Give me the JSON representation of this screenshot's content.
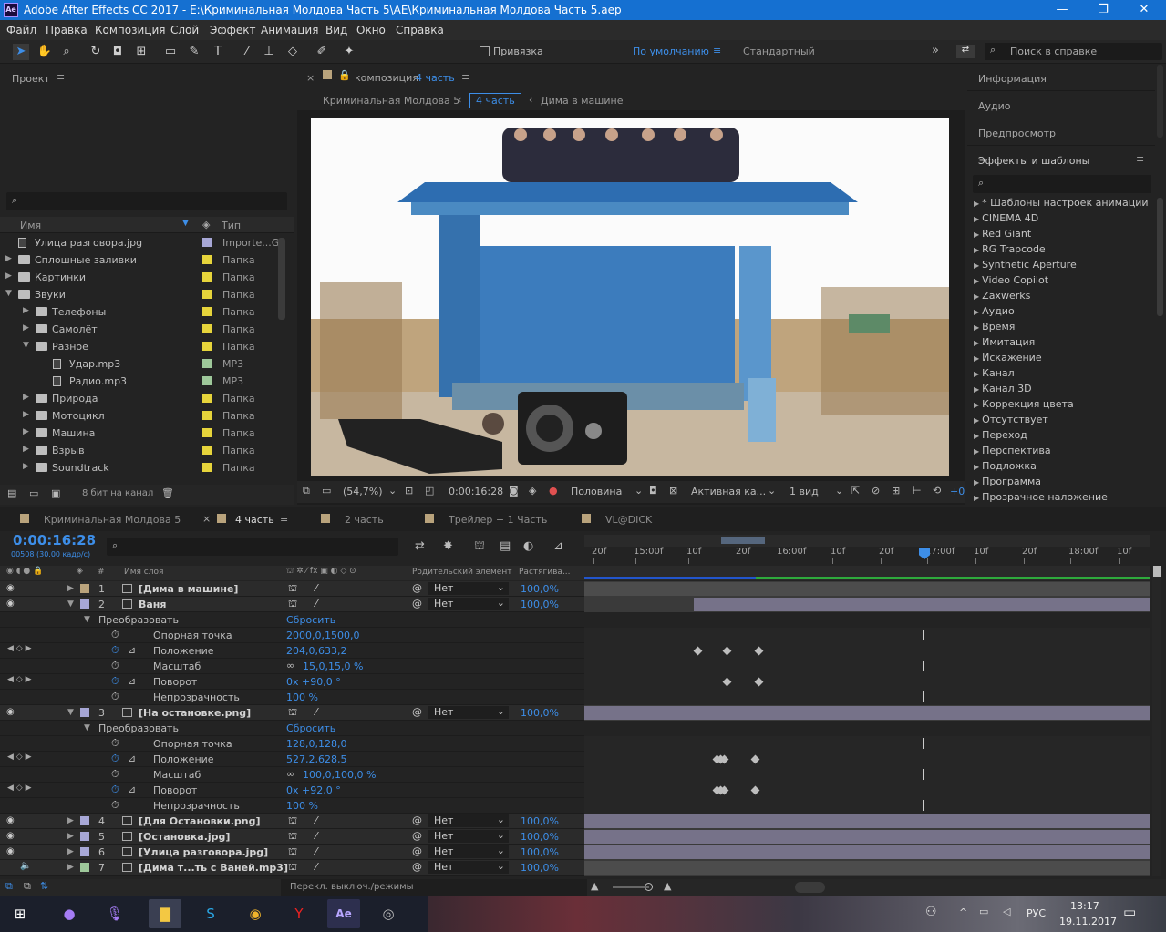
{
  "window": {
    "title": "Adobe After Effects CC 2017 - E:\\Криминальная Молдова Часть 5\\AE\\Криминальная Молдова Часть 5.aep",
    "logo": "Ae"
  },
  "menu": [
    "Файл",
    "Правка",
    "Композиция",
    "Слой",
    "Эффект",
    "Анимация",
    "Вид",
    "Окно",
    "Справка"
  ],
  "toolbar": {
    "snap_label": "Привязка",
    "workspace_active": "По умолчанию",
    "workspace_other": "Стандартный",
    "search_placeholder": "Поиск в справке"
  },
  "project": {
    "title": "Проект",
    "col_name": "Имя",
    "col_type": "Тип",
    "items": [
      {
        "name": "Улица разговора.jpg",
        "type": "Importe...G",
        "color": "#a7a7d6",
        "indent": 0,
        "kind": "file"
      },
      {
        "name": "Сплошные заливки",
        "type": "Папка",
        "color": "#e6d43b",
        "indent": 0,
        "kind": "folder"
      },
      {
        "name": "Картинки",
        "type": "Папка",
        "color": "#e6d43b",
        "indent": 0,
        "kind": "folder"
      },
      {
        "name": "Звуки",
        "type": "Папка",
        "color": "#e6d43b",
        "indent": 0,
        "kind": "folder-open"
      },
      {
        "name": "Телефоны",
        "type": "Папка",
        "color": "#e6d43b",
        "indent": 1,
        "kind": "folder"
      },
      {
        "name": "Самолёт",
        "type": "Папка",
        "color": "#e6d43b",
        "indent": 1,
        "kind": "folder"
      },
      {
        "name": "Разное",
        "type": "Папка",
        "color": "#e6d43b",
        "indent": 1,
        "kind": "folder-open"
      },
      {
        "name": "Удар.mp3",
        "type": "MP3",
        "color": "#9ec89a",
        "indent": 2,
        "kind": "file"
      },
      {
        "name": "Радио.mp3",
        "type": "MP3",
        "color": "#9ec89a",
        "indent": 2,
        "kind": "file"
      },
      {
        "name": "Природа",
        "type": "Папка",
        "color": "#e6d43b",
        "indent": 1,
        "kind": "folder"
      },
      {
        "name": "Мотоцикл",
        "type": "Папка",
        "color": "#e6d43b",
        "indent": 1,
        "kind": "folder"
      },
      {
        "name": "Машина",
        "type": "Папка",
        "color": "#e6d43b",
        "indent": 1,
        "kind": "folder"
      },
      {
        "name": "Взрыв",
        "type": "Папка",
        "color": "#e6d43b",
        "indent": 1,
        "kind": "folder"
      },
      {
        "name": "Soundtrack",
        "type": "Папка",
        "color": "#e6d43b",
        "indent": 1,
        "kind": "folder"
      }
    ],
    "bpc": "8 бит на канал"
  },
  "comp": {
    "tab_prefix": "композиция",
    "tab_name": "4 часть",
    "breadcrumbs": [
      "Криминальная Молдова 5",
      "4 часть",
      "Дима в машине"
    ],
    "zoom": "(54,7%)",
    "time": "0:00:16:28",
    "resolution": "Половина",
    "camera": "Активная ка...",
    "views": "1 вид",
    "exposure": "+0"
  },
  "right_panels": {
    "info": "Информация",
    "audio": "Аудио",
    "preview": "Предпросмотр",
    "effects": "Эффекты и шаблоны",
    "effects_list": [
      "* Шаблоны настроек анимации",
      "CINEMA 4D",
      "Red Giant",
      "RG Trapcode",
      "Synthetic Aperture",
      "Video Copilot",
      "Zaxwerks",
      "Аудио",
      "Время",
      "Имитация",
      "Искажение",
      "Канал",
      "Канал 3D",
      "Коррекция цвета",
      "Отсутствует",
      "Переход",
      "Перспектива",
      "Подложка",
      "Программа",
      "Прозрачное наложение"
    ]
  },
  "timeline": {
    "tabs": [
      {
        "label": "Криминальная Молдова 5",
        "color": "#b9a37c"
      },
      {
        "label": "4 часть",
        "color": "#b9a37c",
        "active": true
      },
      {
        "label": "2 часть",
        "color": "#b9a37c"
      },
      {
        "label": "Трейлер + 1 Часть",
        "color": "#b9a37c"
      },
      {
        "label": "VL@DICK",
        "color": "#b9a37c"
      }
    ],
    "current_time": "0:00:16:28",
    "frame_info": "00508 (30.00 кадр/с)",
    "col_num": "#",
    "col_name": "Имя слоя",
    "col_parent": "Родительский элемент",
    "col_stretch": "Растягива...",
    "ruler": [
      "20f",
      "15:00f",
      "10f",
      "20f",
      "16:00f",
      "10f",
      "20f",
      "17:00f",
      "10f",
      "20f",
      "18:00f",
      "10f"
    ],
    "footer": "Перекл. выключ./режимы",
    "parent_none": "Нет"
  },
  "layers": [
    {
      "kind": "layer",
      "num": "1",
      "name": "[Дима в машине]",
      "color": "#b9a37c",
      "stretch": "100,0%",
      "eye": true,
      "expanded": false
    },
    {
      "kind": "layer",
      "num": "2",
      "name": "Ваня",
      "color": "#a7a7d6",
      "stretch": "100,0%",
      "eye": true,
      "expanded": true
    },
    {
      "kind": "group",
      "name": "Преобразовать",
      "value": "Сбросить"
    },
    {
      "kind": "prop",
      "name": "Опорная точка",
      "value": "2000,0,1500,0"
    },
    {
      "kind": "prop",
      "name": "Положение",
      "value": "204,0,633,2",
      "anim": true
    },
    {
      "kind": "prop",
      "name": "Масштаб",
      "value": "15,0,15,0 %",
      "link": true
    },
    {
      "kind": "prop",
      "name": "Поворот",
      "value": "0x +90,0 °",
      "anim": true
    },
    {
      "kind": "prop",
      "name": "Непрозрачность",
      "value": "100 %"
    },
    {
      "kind": "layer",
      "num": "3",
      "name": "[На остановке.png]",
      "color": "#a7a7d6",
      "stretch": "100,0%",
      "eye": true,
      "expanded": true
    },
    {
      "kind": "group",
      "name": "Преобразовать",
      "value": "Сбросить"
    },
    {
      "kind": "prop",
      "name": "Опорная точка",
      "value": "128,0,128,0"
    },
    {
      "kind": "prop",
      "name": "Положение",
      "value": "527,2,628,5",
      "anim": true
    },
    {
      "kind": "prop",
      "name": "Масштаб",
      "value": "100,0,100,0 %",
      "link": true
    },
    {
      "kind": "prop",
      "name": "Поворот",
      "value": "0x +92,0 °",
      "anim": true
    },
    {
      "kind": "prop",
      "name": "Непрозрачность",
      "value": "100 %"
    },
    {
      "kind": "layer",
      "num": "4",
      "name": "[Для Остановки.png]",
      "color": "#a7a7d6",
      "stretch": "100,0%",
      "eye": true,
      "expanded": false
    },
    {
      "kind": "layer",
      "num": "5",
      "name": "[Остановка.jpg]",
      "color": "#a7a7d6",
      "stretch": "100,0%",
      "eye": true,
      "expanded": false
    },
    {
      "kind": "layer",
      "num": "6",
      "name": "[Улица разговора.jpg]",
      "color": "#a7a7d6",
      "stretch": "100,0%",
      "eye": true,
      "expanded": false
    },
    {
      "kind": "layer",
      "num": "7",
      "name": "[Дима т...ть с Ваней.mp3]",
      "color": "#9ec89a",
      "stretch": "100,0%",
      "eye": false,
      "expanded": false
    }
  ],
  "taskbar": {
    "lang": "РУС",
    "time": "13:17",
    "date": "19.11.2017"
  }
}
